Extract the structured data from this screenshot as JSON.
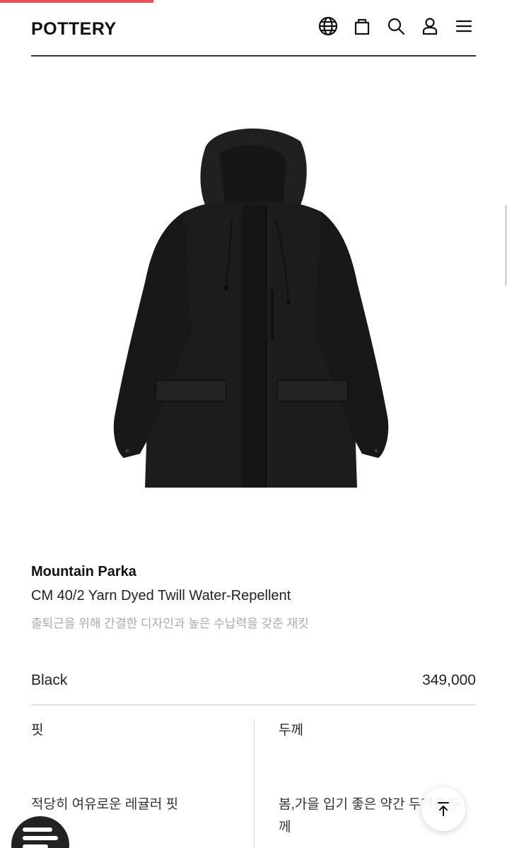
{
  "header": {
    "logo": "POTTERY",
    "icons": [
      "globe-icon",
      "shopping-bag-icon",
      "search-icon",
      "user-icon",
      "menu-icon"
    ]
  },
  "product": {
    "name": "Mountain Parka",
    "material": "CM 40/2 Yarn Dyed Twill Water-Repellent",
    "description": "출퇴근을 위해 간결한 디자인과 높은 수납력을 갖춘 재킷",
    "color": "Black",
    "price": "349,000"
  },
  "specs": {
    "fit": {
      "title": "핏",
      "value": "적당히 여유로운 레귤러 핏"
    },
    "thickness": {
      "title": "두께",
      "value": "봄,가을 입기 좋은 약간 두꺼운 두께"
    }
  },
  "colors": {
    "accent": "#e8505b",
    "text": "#111111",
    "muted": "#aaaaaa"
  }
}
